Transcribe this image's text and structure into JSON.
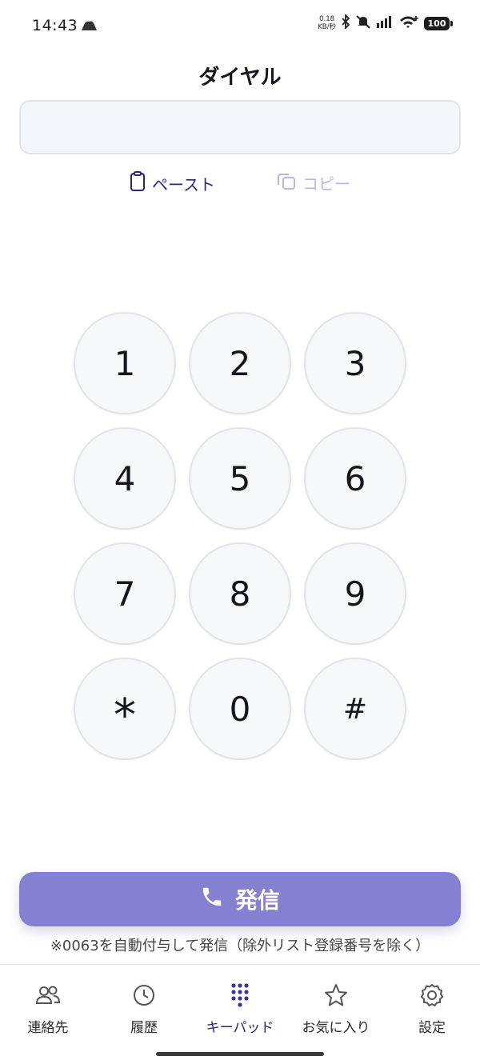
{
  "status_bar": {
    "time": "14:43",
    "net_speed_value": "0.18",
    "net_speed_unit": "KB/秒",
    "battery": "100"
  },
  "header": {
    "title": "ダイヤル"
  },
  "dial_input": {
    "value": "",
    "placeholder": ""
  },
  "actions": {
    "paste_label": "ペースト",
    "copy_label": "コピー"
  },
  "keypad": {
    "keys": [
      "1",
      "2",
      "3",
      "4",
      "5",
      "6",
      "7",
      "8",
      "9",
      "*",
      "0",
      "#"
    ]
  },
  "call": {
    "label": "発信",
    "note": "※0063を自動付与して発信（除外リスト登録番号を除く）"
  },
  "nav": {
    "items": [
      {
        "label": "連絡先",
        "icon": "contacts-icon"
      },
      {
        "label": "履歴",
        "icon": "clock-icon"
      },
      {
        "label": "キーパッド",
        "icon": "keypad-icon"
      },
      {
        "label": "お気に入り",
        "icon": "star-icon"
      },
      {
        "label": "設定",
        "icon": "gear-icon"
      }
    ],
    "active": "キーパッド"
  },
  "colors": {
    "accent": "#2a2680",
    "call_button": "#8580d1",
    "key_background": "#f7f8fa",
    "input_background": "#f5f6f9"
  }
}
